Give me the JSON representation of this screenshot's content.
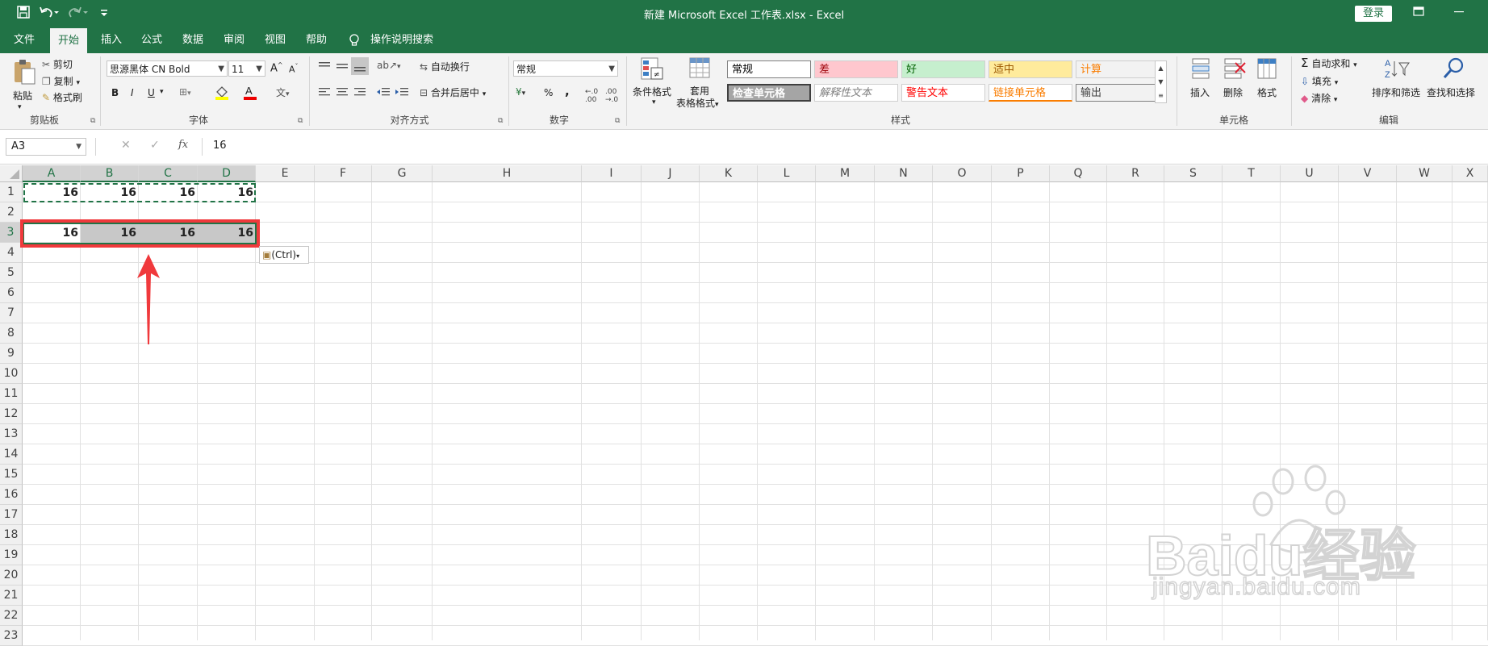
{
  "window": {
    "title": "新建 Microsoft Excel 工作表.xlsx  -  Excel",
    "login_label": "登录",
    "brand_color": "#217346"
  },
  "quick_access": {
    "icons": [
      "save-icon",
      "undo-icon",
      "redo-icon",
      "customize-icon"
    ]
  },
  "tabs": [
    "文件",
    "开始",
    "插入",
    "公式",
    "数据",
    "审阅",
    "视图",
    "帮助"
  ],
  "active_tab": "开始",
  "tell_me": "操作说明搜索",
  "ribbon": {
    "clipboard": {
      "label": "剪贴板",
      "paste": "粘贴",
      "cut": "剪切",
      "copy": "复制",
      "format_painter": "格式刷"
    },
    "font": {
      "label": "字体",
      "font_name": "思源黑体 CN Bold",
      "font_size": "11",
      "bold": "B",
      "italic": "I",
      "underline": "U"
    },
    "alignment": {
      "label": "对齐方式",
      "wrap_text": "自动换行",
      "merge_center": "合并后居中"
    },
    "number": {
      "label": "数字",
      "format": "常规",
      "percent": "%",
      "comma": ","
    },
    "styles": {
      "label": "样式",
      "conditional_format": "条件格式",
      "table_format_line1": "套用",
      "table_format_line2": "表格格式",
      "cells": [
        {
          "text": "常规",
          "bg": "#ffffff",
          "color": "#000000"
        },
        {
          "text": "差",
          "bg": "#ffc7ce",
          "color": "#9c0006"
        },
        {
          "text": "好",
          "bg": "#c6efce",
          "color": "#006100"
        },
        {
          "text": "适中",
          "bg": "#ffeb9c",
          "color": "#9c5700"
        },
        {
          "text": "计算",
          "bg": "#f2f2f2",
          "color": "#fa7d00"
        },
        {
          "text": "检查单元格",
          "bg": "#a5a5a5",
          "color": "#ffffff"
        },
        {
          "text": "解释性文本",
          "bg": "#ffffff",
          "color": "#7f7f7f"
        },
        {
          "text": "警告文本",
          "bg": "#ffffff",
          "color": "#ff0000"
        },
        {
          "text": "链接单元格",
          "bg": "#ffffff",
          "color": "#fa7d00"
        },
        {
          "text": "输出",
          "bg": "#f2f2f2",
          "color": "#3f3f3f"
        }
      ]
    },
    "cells_group": {
      "label": "单元格",
      "insert": "插入",
      "delete": "删除",
      "format": "格式"
    },
    "editing": {
      "label": "编辑",
      "autosum": "自动求和",
      "fill": "填充",
      "clear": "清除",
      "sort_filter": "排序和筛选",
      "find_select": "查找和选择"
    }
  },
  "formula_bar": {
    "name_box": "A3",
    "fx": "fx",
    "value": "16"
  },
  "columns": [
    "A",
    "B",
    "C",
    "D",
    "E",
    "F",
    "G",
    "H",
    "I",
    "J",
    "K",
    "L",
    "M",
    "N",
    "O",
    "P",
    "Q",
    "R",
    "S",
    "T",
    "U",
    "V",
    "W",
    "X"
  ],
  "rows": [
    "1",
    "2",
    "3",
    "4",
    "5",
    "6",
    "7",
    "8",
    "9",
    "10",
    "11",
    "12",
    "13",
    "14",
    "15",
    "16",
    "17",
    "18",
    "19",
    "20",
    "21",
    "22",
    "23"
  ],
  "cells": {
    "row1": [
      "16",
      "16",
      "16",
      "16"
    ],
    "row3": [
      "16",
      "16",
      "16",
      "16"
    ]
  },
  "paste_options": "(Ctrl)",
  "watermark": {
    "brand": "Baidu经验",
    "url": "jingyan.baidu.com"
  },
  "annotation_color": "#f0393c"
}
